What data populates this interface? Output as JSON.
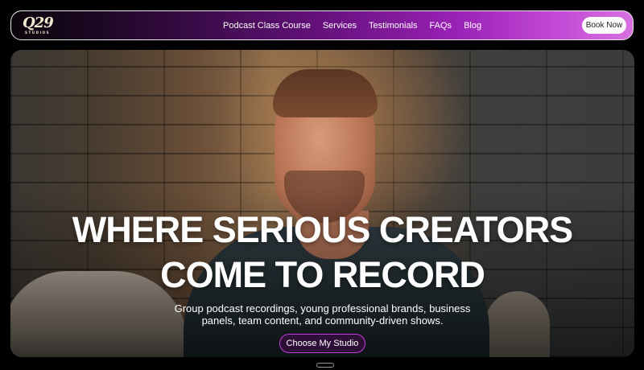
{
  "brand": {
    "logo_mark": "Q29",
    "logo_sub": "STUDIOS"
  },
  "nav": {
    "links": [
      "Podcast Class Course",
      "Services",
      "Testimonials",
      "FAQs",
      "Blog"
    ],
    "book_label": "Book Now"
  },
  "hero": {
    "title_line1": "WHERE SERIOUS CREATORS",
    "title_line2": "COME TO RECORD",
    "subtitle_line1": "Group podcast recordings, young professional brands, business",
    "subtitle_line2": "panels, team content, and community-driven shows.",
    "cta_label": "Choose My Studio"
  },
  "colors": {
    "nav_gradient_end": "#d872e0",
    "cta_border": "#c63ee0"
  }
}
